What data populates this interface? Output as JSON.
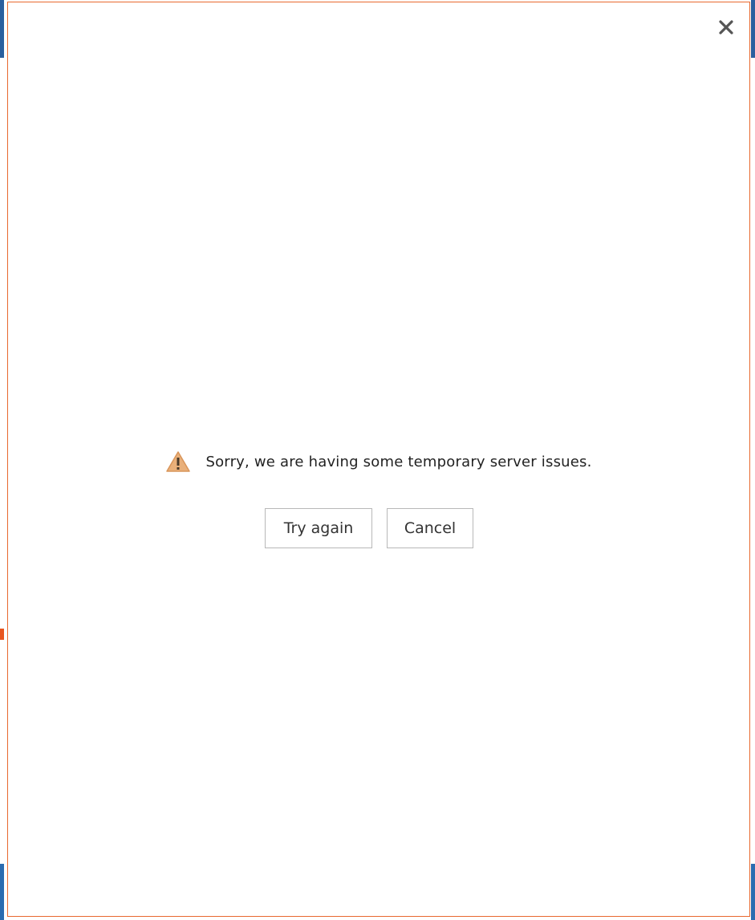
{
  "dialog": {
    "close_icon": "close-icon",
    "message": "Sorry, we are having some temporary server issues.",
    "message_icon": "warning-icon",
    "buttons": {
      "try_again": "Try again",
      "cancel": "Cancel"
    }
  },
  "colors": {
    "dialog_border": "#e8692f",
    "warning_fill": "#e9b07a",
    "warning_mark": "#4a3a2a",
    "close_icon": "#555555",
    "button_border": "#b8b8b8"
  }
}
